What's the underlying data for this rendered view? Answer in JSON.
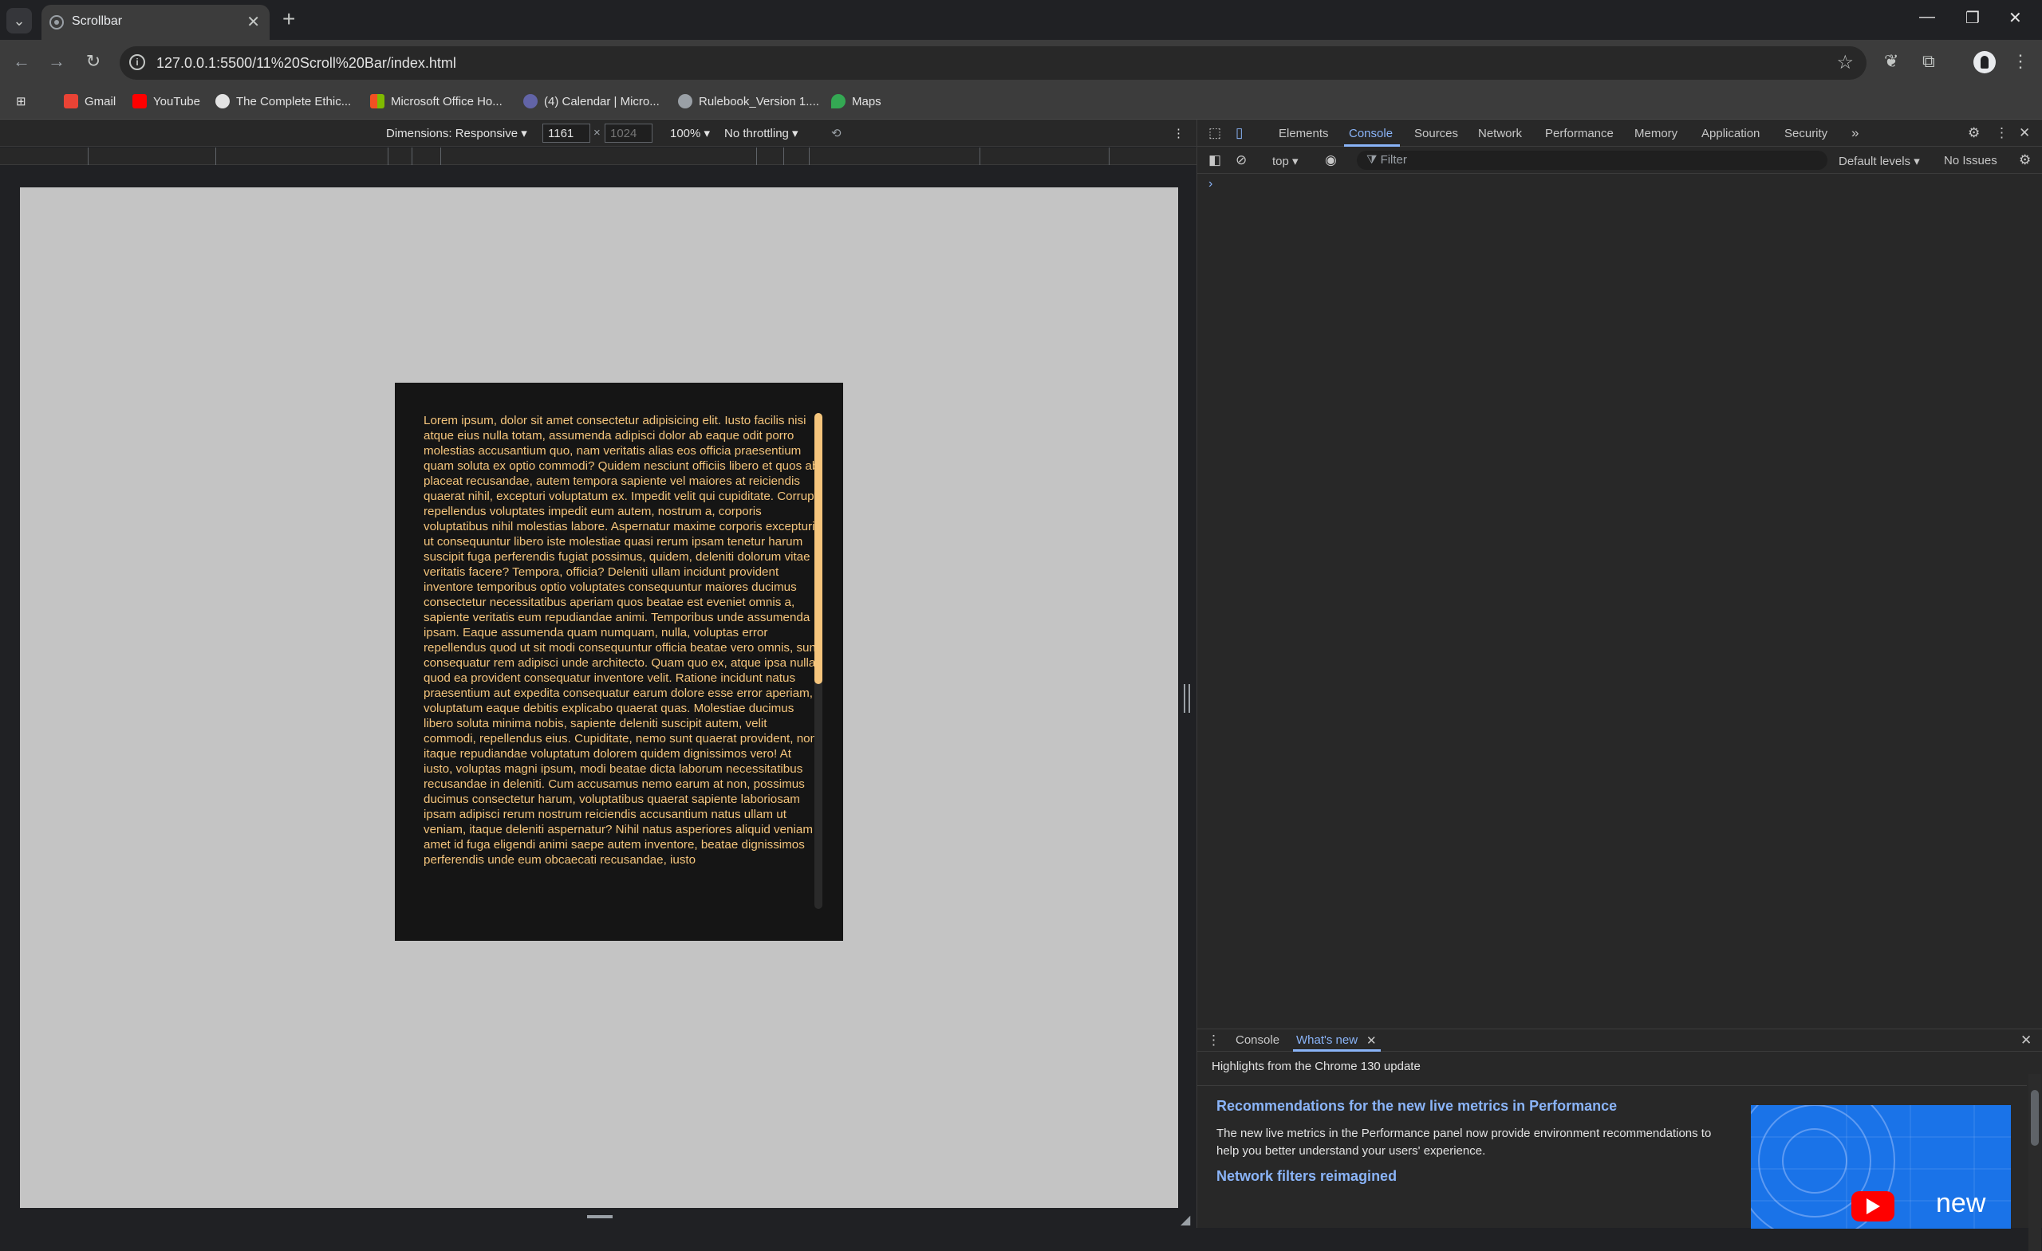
{
  "browser": {
    "tab_title": "Scrollbar",
    "url": "127.0.0.1:5500/11%20Scroll%20Bar/index.html",
    "bookmarks": [
      {
        "label": "Gmail",
        "icon": "gmail-icon",
        "color": "#ea4335"
      },
      {
        "label": "YouTube",
        "icon": "youtube-icon",
        "color": "#ff0000"
      },
      {
        "label": "The Complete Ethic...",
        "icon": "wordpress-icon",
        "color": "#e3e3e3"
      },
      {
        "label": "Microsoft Office Ho...",
        "icon": "microsoft-icon",
        "color": "#f25022"
      },
      {
        "label": "(4) Calendar | Micro...",
        "icon": "teams-icon",
        "color": "#6264a7"
      },
      {
        "label": "Rulebook_Version 1....",
        "icon": "globe-icon",
        "color": "#9aa0a6"
      },
      {
        "label": "Maps",
        "icon": "maps-icon",
        "color": "#34a853"
      }
    ]
  },
  "device_toolbar": {
    "dimensions_label": "Dimensions: Responsive",
    "width": "1161",
    "height_placeholder": "1024",
    "zoom": "100%",
    "throttling": "No throttling"
  },
  "page": {
    "lorem": "Lorem ipsum, dolor sit amet consectetur adipisicing elit. Iusto facilis nisi atque eius nulla totam, assumenda adipisci dolor ab eaque odit porro molestias accusantium quo, nam veritatis alias eos officia praesentium quam soluta ex optio commodi? Quidem nesciunt officiis libero et quos ab placeat recusandae, autem tempora sapiente vel maiores at reiciendis quaerat nihil, excepturi voluptatum ex. Impedit velit qui cupiditate. Corrupti repellendus voluptates impedit eum autem, nostrum a, corporis voluptatibus nihil molestias labore. Aspernatur maxime corporis excepturi, ut consequuntur libero iste molestiae quasi rerum ipsam tenetur harum suscipit fuga perferendis fugiat possimus, quidem, deleniti dolorum vitae veritatis facere? Tempora, officia? Deleniti ullam incidunt provident inventore temporibus optio voluptates consequuntur maiores ducimus consectetur necessitatibus aperiam quos beatae est eveniet omnis a, sapiente veritatis eum repudiandae animi. Temporibus unde assumenda ipsam. Eaque assumenda quam numquam, nulla, voluptas error repellendus quod ut sit modi consequuntur officia beatae vero omnis, sunt consequatur rem adipisci unde architecto. Quam quo ex, atque ipsa nulla quod ea provident consequatur inventore velit. Ratione incidunt natus praesentium aut expedita consequatur earum dolore esse error aperiam, voluptatum eaque debitis explicabo quaerat quas. Molestiae ducimus libero soluta minima nobis, sapiente deleniti suscipit autem, velit commodi, repellendus eius. Cupiditate, nemo sunt quaerat provident, non itaque repudiandae voluptatum dolorem quidem dignissimos vero! At iusto, voluptas magni ipsum, modi beatae dicta laborum necessitatibus recusandae in deleniti. Cum accusamus nemo earum at non, possimus ducimus consectetur harum, voluptatibus quaerat sapiente laboriosam ipsam adipisci rerum nostrum reiciendis accusantium natus ullam ut veniam, itaque deleniti aspernatur? Nihil natus asperiores aliquid veniam amet id fuga eligendi animi saepe autem inventore, beatae dignissimos perferendis unde eum obcaecati recusandae, iusto",
    "text_color": "#f5c57c",
    "card_color": "#151515"
  },
  "devtools": {
    "tabs": [
      "Elements",
      "Console",
      "Sources",
      "Network",
      "Performance",
      "Memory",
      "Application",
      "Security"
    ],
    "active_tab": "Console",
    "context": "top",
    "filter_placeholder": "Filter",
    "levels": "Default levels",
    "issues": "No Issues",
    "prompt": "›",
    "drawer_tabs": [
      "Console",
      "What's new"
    ],
    "whats_new": {
      "heading": "Highlights from the Chrome 130 update",
      "item1_title": "Recommendations for the new live metrics in Performance",
      "item1_text": "The new live metrics in the Performance panel now provide environment recommendations to help you better understand your users' experience.",
      "item2_title": "Network filters reimagined",
      "image_text": "new"
    }
  }
}
